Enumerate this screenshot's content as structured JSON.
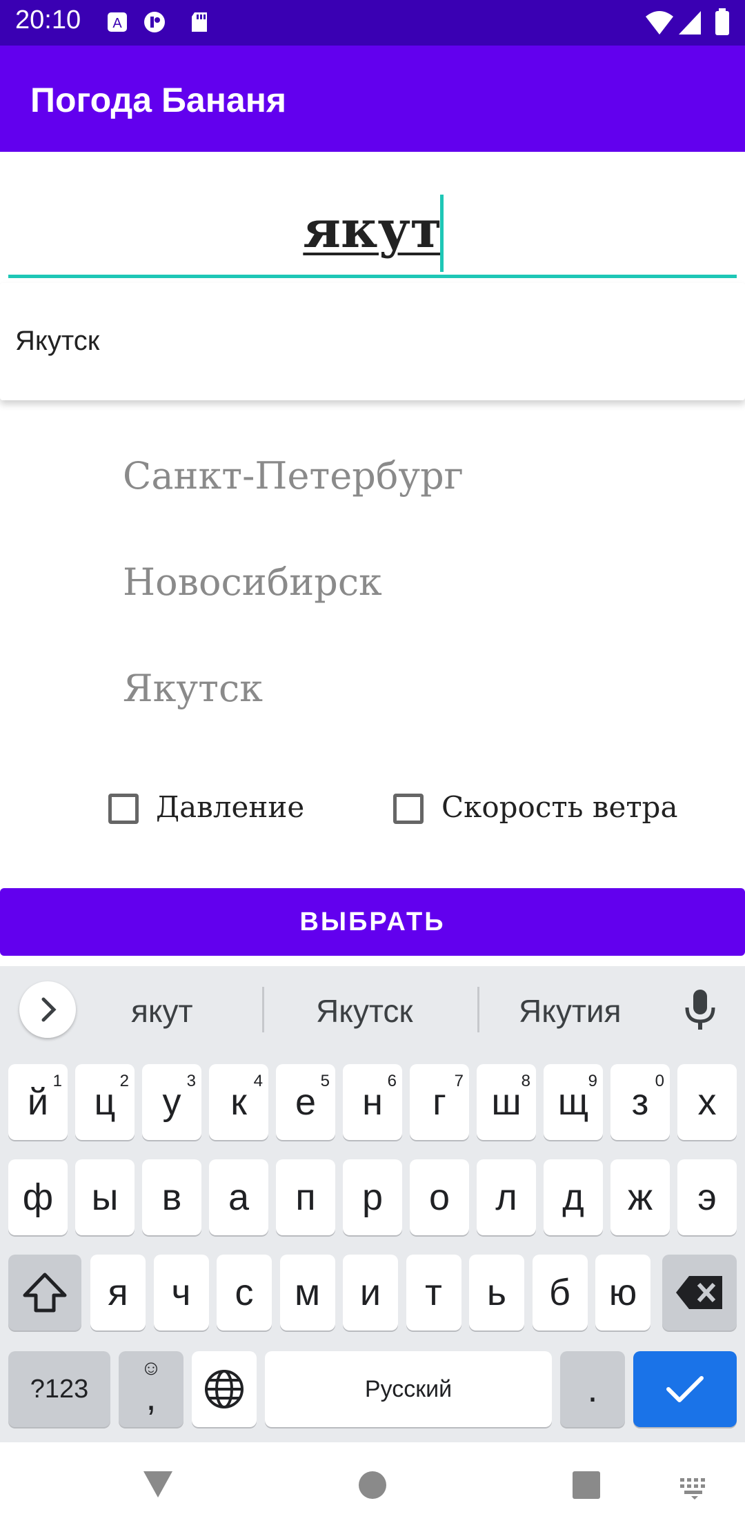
{
  "status_bar": {
    "time": "20:10"
  },
  "app": {
    "title": "Погода Бананя"
  },
  "search": {
    "value": "якут"
  },
  "suggest_popup": {
    "item": "Якутск"
  },
  "cities": [
    "Санкт-Петербург",
    "Новосибирск",
    "Якутск"
  ],
  "checkboxes": [
    {
      "label": "Давление",
      "checked": false
    },
    {
      "label": "Скорость ветра",
      "checked": false
    }
  ],
  "select_button": {
    "label": "ВЫБРАТЬ"
  },
  "keyboard": {
    "suggestions": [
      "якут",
      "Якутск",
      "Якутия"
    ],
    "row1": [
      {
        "k": "й",
        "n": "1"
      },
      {
        "k": "ц",
        "n": "2"
      },
      {
        "k": "у",
        "n": "3"
      },
      {
        "k": "к",
        "n": "4"
      },
      {
        "k": "е",
        "n": "5"
      },
      {
        "k": "н",
        "n": "6"
      },
      {
        "k": "г",
        "n": "7"
      },
      {
        "k": "ш",
        "n": "8"
      },
      {
        "k": "щ",
        "n": "9"
      },
      {
        "k": "з",
        "n": "0"
      },
      {
        "k": "х",
        "n": ""
      }
    ],
    "row2": [
      "ф",
      "ы",
      "в",
      "а",
      "п",
      "р",
      "о",
      "л",
      "д",
      "ж",
      "э"
    ],
    "row3": [
      "я",
      "ч",
      "с",
      "м",
      "и",
      "т",
      "ь",
      "б",
      "ю"
    ],
    "symbols_label": "?123",
    "emoji_comma_label": ",",
    "space_label": "Русский",
    "period_label": "."
  }
}
